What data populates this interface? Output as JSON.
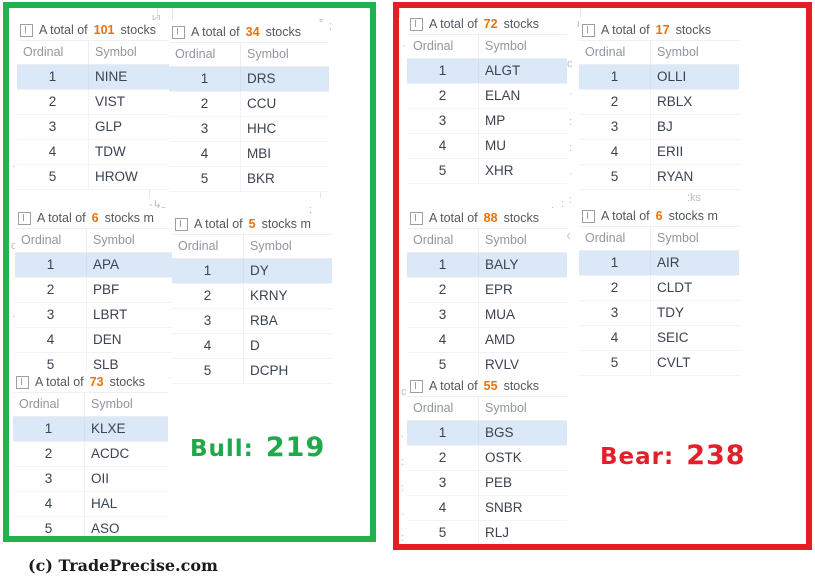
{
  "watermark": "(c) TradePrecise.com",
  "colors": {
    "bull_border": "#21b24b",
    "bear_border": "#e31f26",
    "bull_text": "#21a84a",
    "bear_text": "#e3202a",
    "count_highlight": "#e8730a",
    "row_selected": "#dbe8f7"
  },
  "common": {
    "total_prefix": "A total of",
    "total_suffix": "stocks",
    "total_suffix_truncated": "stocks m",
    "col_ordinal": "Ordinal",
    "col_symbol": "Symbol"
  },
  "bull": {
    "label": "Bull:",
    "value": "219",
    "tables": [
      {
        "id": "bull-t1",
        "total": "101",
        "suffix": "stocks",
        "ordinal_label": "Ordinal",
        "symbol_label": "Symbol",
        "rows": [
          {
            "ordinal": "1",
            "symbol": "NINE"
          },
          {
            "ordinal": "2",
            "symbol": "VIST"
          },
          {
            "ordinal": "3",
            "symbol": "GLP"
          },
          {
            "ordinal": "4",
            "symbol": "TDW"
          },
          {
            "ordinal": "5",
            "symbol": "HROW"
          }
        ]
      },
      {
        "id": "bull-t2",
        "total": "34",
        "suffix": "stocks",
        "ordinal_label": "Ordinal",
        "symbol_label": "Symbol",
        "rows": [
          {
            "ordinal": "1",
            "symbol": "DRS"
          },
          {
            "ordinal": "2",
            "symbol": "CCU"
          },
          {
            "ordinal": "3",
            "symbol": "HHC"
          },
          {
            "ordinal": "4",
            "symbol": "MBI"
          },
          {
            "ordinal": "5",
            "symbol": "BKR"
          }
        ]
      },
      {
        "id": "bull-t3",
        "total": "6",
        "suffix": "stocks m",
        "ordinal_label": "Ordinal",
        "symbol_label": "Symbol",
        "rows": [
          {
            "ordinal": "1",
            "symbol": "APA"
          },
          {
            "ordinal": "2",
            "symbol": "PBF"
          },
          {
            "ordinal": "3",
            "symbol": "LBRT"
          },
          {
            "ordinal": "4",
            "symbol": "DEN"
          },
          {
            "ordinal": "5",
            "symbol": "SLB"
          }
        ]
      },
      {
        "id": "bull-t4",
        "total": "5",
        "suffix": "stocks m",
        "ordinal_label": "Ordinal",
        "symbol_label": "Symbol",
        "rows": [
          {
            "ordinal": "1",
            "symbol": "DY"
          },
          {
            "ordinal": "2",
            "symbol": "KRNY"
          },
          {
            "ordinal": "3",
            "symbol": "RBA"
          },
          {
            "ordinal": "4",
            "symbol": "D"
          },
          {
            "ordinal": "5",
            "symbol": "DCPH"
          }
        ]
      },
      {
        "id": "bull-t5",
        "total": "73",
        "suffix": "stocks",
        "ordinal_label": "Ordinal",
        "symbol_label": "Symbol",
        "rows": [
          {
            "ordinal": "1",
            "symbol": "KLXE"
          },
          {
            "ordinal": "2",
            "symbol": "ACDC"
          },
          {
            "ordinal": "3",
            "symbol": "OII"
          },
          {
            "ordinal": "4",
            "symbol": "HAL"
          },
          {
            "ordinal": "5",
            "symbol": "ASO"
          }
        ]
      }
    ]
  },
  "bear": {
    "label": "Bear:",
    "value": "238",
    "tables": [
      {
        "id": "bear-t1",
        "total": "72",
        "suffix": "stocks",
        "ordinal_label": "Ordinal",
        "symbol_label": "Symbol",
        "rows": [
          {
            "ordinal": "1",
            "symbol": "ALGT"
          },
          {
            "ordinal": "2",
            "symbol": "ELAN"
          },
          {
            "ordinal": "3",
            "symbol": "MP"
          },
          {
            "ordinal": "4",
            "symbol": "MU"
          },
          {
            "ordinal": "5",
            "symbol": "XHR"
          }
        ]
      },
      {
        "id": "bear-t2",
        "total": "17",
        "suffix": "stocks",
        "ordinal_label": "Ordinal",
        "symbol_label": "Symbol",
        "rows": [
          {
            "ordinal": "1",
            "symbol": "OLLI"
          },
          {
            "ordinal": "2",
            "symbol": "RBLX"
          },
          {
            "ordinal": "3",
            "symbol": "BJ"
          },
          {
            "ordinal": "4",
            "symbol": "ERII"
          },
          {
            "ordinal": "5",
            "symbol": "RYAN"
          }
        ]
      },
      {
        "id": "bear-t3",
        "total": "88",
        "suffix": "stocks",
        "ordinal_label": "Ordinal",
        "symbol_label": "Symbol",
        "rows": [
          {
            "ordinal": "1",
            "symbol": "BALY"
          },
          {
            "ordinal": "2",
            "symbol": "EPR"
          },
          {
            "ordinal": "3",
            "symbol": "MUA"
          },
          {
            "ordinal": "4",
            "symbol": "AMD"
          },
          {
            "ordinal": "5",
            "symbol": "RVLV"
          }
        ]
      },
      {
        "id": "bear-t4",
        "total": "6",
        "suffix": "stocks m",
        "ordinal_label": "Ordinal",
        "symbol_label": "Symbol",
        "rows": [
          {
            "ordinal": "1",
            "symbol": "AIR"
          },
          {
            "ordinal": "2",
            "symbol": "CLDT"
          },
          {
            "ordinal": "3",
            "symbol": "TDY"
          },
          {
            "ordinal": "4",
            "symbol": "SEIC"
          },
          {
            "ordinal": "5",
            "symbol": "CVLT"
          }
        ]
      },
      {
        "id": "bear-t5",
        "total": "55",
        "suffix": "stocks",
        "ordinal_label": "Ordinal",
        "symbol_label": "Symbol",
        "rows": [
          {
            "ordinal": "1",
            "symbol": "BGS"
          },
          {
            "ordinal": "2",
            "symbol": "OSTK"
          },
          {
            "ordinal": "3",
            "symbol": "PEB"
          },
          {
            "ordinal": "4",
            "symbol": "SNBR"
          },
          {
            "ordinal": "5",
            "symbol": "RLJ"
          }
        ]
      }
    ]
  }
}
